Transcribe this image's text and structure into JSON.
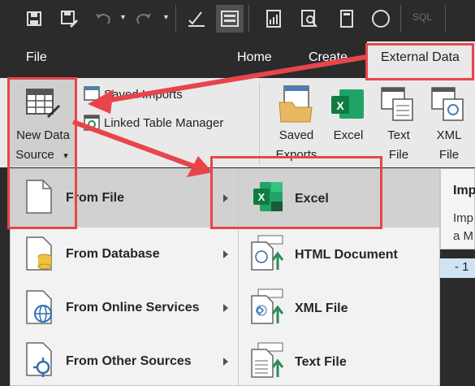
{
  "quick_access": {
    "icons": [
      "save-icon",
      "save-as-icon",
      "undo-icon",
      "redo-icon",
      "design-view-icon",
      "form-view-icon",
      "report-icon",
      "query-icon",
      "notebook-icon",
      "circle-icon"
    ],
    "sql_label": "SQL"
  },
  "tabs": {
    "file": "File",
    "home": "Home",
    "create": "Create",
    "external_data": "External Data"
  },
  "ribbon": {
    "new_data_source": {
      "line1": "New Data",
      "line2": "Source",
      "caret": "▾"
    },
    "saved_imports": "Saved Imports",
    "linked_table_manager": "Linked Table Manager",
    "export": {
      "saved_exports": {
        "line1": "Saved",
        "line2": "Exports"
      },
      "excel": "Excel",
      "text_file": {
        "line1": "Text",
        "line2": "File"
      },
      "xml_file": {
        "line1": "XML",
        "line2": "File"
      }
    }
  },
  "menu_sources": {
    "items": [
      {
        "label": "From File",
        "icon": "file-icon"
      },
      {
        "label": "From Database",
        "icon": "database-icon"
      },
      {
        "label": "From Online Services",
        "icon": "globe-icon"
      },
      {
        "label": "From Other Sources",
        "icon": "connector-icon"
      }
    ]
  },
  "menu_file": {
    "items": [
      {
        "label": "Excel",
        "icon": "excel-icon"
      },
      {
        "label": "HTML Document",
        "icon": "html-document-icon"
      },
      {
        "label": "XML File",
        "icon": "xml-file-icon"
      },
      {
        "label": "Text File",
        "icon": "text-file-icon"
      }
    ]
  },
  "tooltip": {
    "title": "Imp",
    "line1": "Imp",
    "line2": "a M"
  },
  "status_bar_text": "- 1",
  "colors": {
    "annotation_red": "#e8454b",
    "excel_green": "#1d6f42",
    "accent_dark": "#2b2b2b"
  }
}
